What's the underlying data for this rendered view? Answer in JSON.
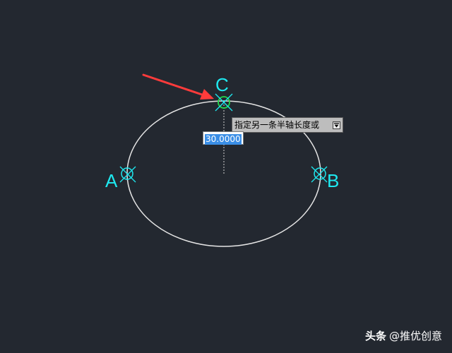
{
  "points": {
    "a_label": "A",
    "b_label": "B",
    "c_label": "C"
  },
  "prompt": {
    "tooltip_text": "指定另一条半轴长度或",
    "input_value": "30.0000",
    "dropdown_icon": "down-arrow-icon"
  },
  "watermark": {
    "brand": "头条",
    "author": "@推优创意"
  },
  "colors": {
    "background": "#232830",
    "ellipse": "#e6e6e6",
    "grip_cyan": "#1ee9f0",
    "grip_green": "#22d84a",
    "arrow": "#ff3b3b",
    "tooltip_bg": "#bdbdbd",
    "input_highlight": "#3a8ee6"
  }
}
